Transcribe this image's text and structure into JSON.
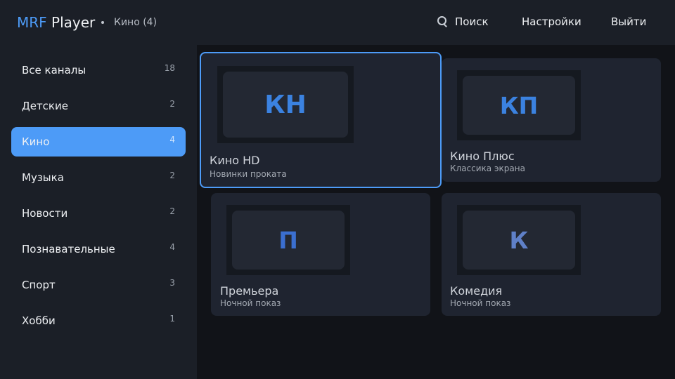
{
  "header": {
    "logo_part1": "MRF",
    "logo_part2": "Player",
    "breadcrumb": "Кино (4)",
    "search_label": "Поиск",
    "settings_label": "Настройки",
    "exit_label": "Выйти"
  },
  "sidebar": {
    "items": [
      {
        "label": "Все каналы",
        "count": "18"
      },
      {
        "label": "Детские",
        "count": "2"
      },
      {
        "label": "Кино",
        "count": "4"
      },
      {
        "label": "Музыка",
        "count": "2"
      },
      {
        "label": "Новости",
        "count": "2"
      },
      {
        "label": "Познавательные",
        "count": "4"
      },
      {
        "label": "Спорт",
        "count": "3"
      },
      {
        "label": "Хобби",
        "count": "1"
      }
    ]
  },
  "channels": [
    {
      "abbr": "КН",
      "title": "Кино HD",
      "subtitle": "Новинки проката"
    },
    {
      "abbr": "КП",
      "title": "Кино Плюс",
      "subtitle": "Классика экрана"
    },
    {
      "abbr": "П",
      "title": "Премьера",
      "subtitle": "Ночной показ"
    },
    {
      "abbr": "К",
      "title": "Комедия",
      "subtitle": "Ночной показ"
    }
  ],
  "colors": {
    "accent": "#4d9bf7",
    "abbr_blue": "#3b82e0",
    "abbr_muted": "#5f80c8"
  }
}
